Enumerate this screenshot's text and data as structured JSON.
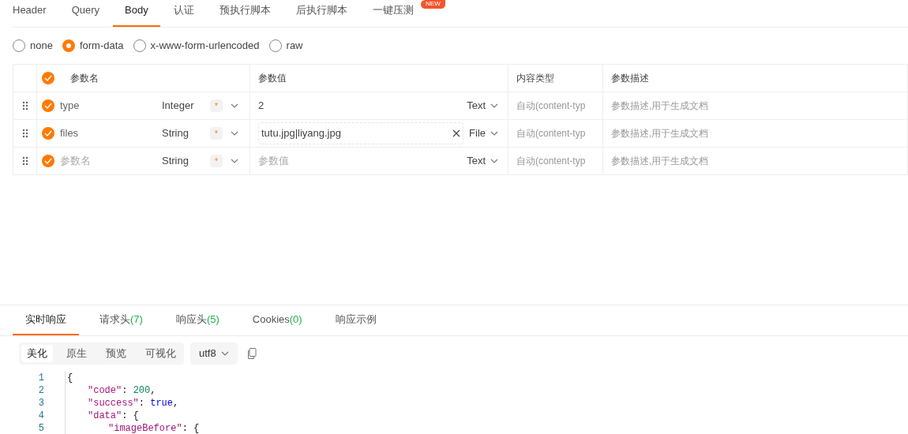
{
  "tabs": [
    {
      "label": "Header",
      "selected": false
    },
    {
      "label": "Query",
      "selected": false
    },
    {
      "label": "Body",
      "selected": true
    },
    {
      "label": "认证",
      "selected": false
    },
    {
      "label": "预执行脚本",
      "selected": false
    },
    {
      "label": "后执行脚本",
      "selected": false
    },
    {
      "label": "一键压测",
      "selected": false,
      "badge": "NEW"
    }
  ],
  "body_types": [
    {
      "label": "none",
      "selected": false
    },
    {
      "label": "form-data",
      "selected": true
    },
    {
      "label": "x-www-form-urlencoded",
      "selected": false
    },
    {
      "label": "raw",
      "selected": false
    }
  ],
  "table": {
    "header": {
      "checked": true,
      "columns": [
        "参数名",
        "参数值",
        "内容类型",
        "参数描述"
      ]
    },
    "rows": [
      {
        "kind": "text",
        "checked": true,
        "name": {
          "value": "type"
        },
        "type": "Integer",
        "required_mark": "*",
        "value": {
          "value": "2"
        },
        "value_type": "Text",
        "content_type": "自动(content-typ",
        "description": "参数描述,用于生成文档"
      },
      {
        "kind": "file",
        "checked": true,
        "name": {
          "value": "files"
        },
        "type": "String",
        "required_mark": "*",
        "value": {
          "value": "tutu.jpg|liyang.jpg"
        },
        "value_type": "File",
        "content_type": "自动(content-typ",
        "description": "参数描述,用于生成文档"
      },
      {
        "kind": "text",
        "checked": true,
        "name": {
          "placeholder": "参数名"
        },
        "type": "String",
        "required_mark": "*",
        "value": {
          "placeholder": "参数值"
        },
        "value_type": "Text",
        "content_type": "自动(content-typ",
        "description": "参数描述,用于生成文档"
      }
    ]
  },
  "response_tabs": [
    {
      "label": "实时响应",
      "selected": true
    },
    {
      "label": "请求头",
      "count": "(7)",
      "selected": false
    },
    {
      "label": "响应头",
      "count": "(5)",
      "selected": false
    },
    {
      "label": "Cookies",
      "count": "(0)",
      "selected": false
    },
    {
      "label": "响应示例",
      "selected": false
    }
  ],
  "view_modes": [
    {
      "label": "美化",
      "selected": true
    },
    {
      "label": "原生",
      "selected": false
    },
    {
      "label": "预览",
      "selected": false
    },
    {
      "label": "可视化",
      "selected": false
    }
  ],
  "encoding": "utf8",
  "code_lines": [
    {
      "number": "1",
      "tokens": [
        {
          "kind": "punct",
          "text": "{"
        }
      ],
      "children": [
        {
          "number": "2",
          "tokens": [
            {
              "kind": "key",
              "text": "\"code\""
            },
            {
              "kind": "punct",
              "text": ": "
            },
            {
              "kind": "number",
              "text": "200"
            },
            {
              "kind": "punct",
              "text": ","
            }
          ]
        },
        {
          "number": "3",
          "tokens": [
            {
              "kind": "key",
              "text": "\"success\""
            },
            {
              "kind": "punct",
              "text": ": "
            },
            {
              "kind": "bool",
              "text": "true"
            },
            {
              "kind": "punct",
              "text": ","
            }
          ]
        },
        {
          "number": "4",
          "tokens": [
            {
              "kind": "key",
              "text": "\"data\""
            },
            {
              "kind": "punct",
              "text": ": {"
            }
          ],
          "children": [
            {
              "number": "5",
              "tokens": [
                {
                  "kind": "key",
                  "text": "\"imageBefore\""
                },
                {
                  "kind": "punct",
                  "text": ": {"
                }
              ]
            }
          ]
        }
      ]
    }
  ]
}
